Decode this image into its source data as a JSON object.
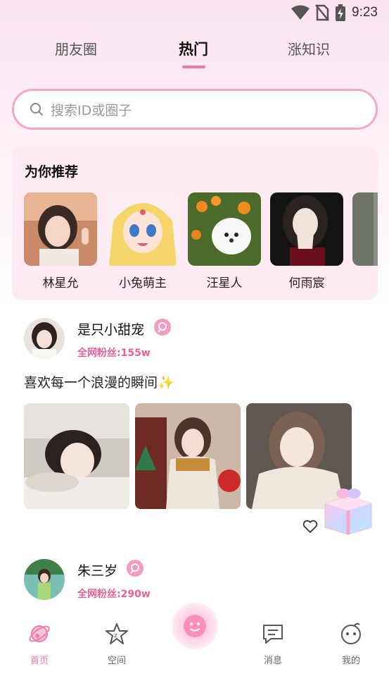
{
  "status_bar": {
    "time": "9:23"
  },
  "tabs": [
    {
      "label": "朋友圈"
    },
    {
      "label": "热门",
      "active": true
    },
    {
      "label": "涨知识"
    }
  ],
  "search": {
    "placeholder": "搜索ID或圈子"
  },
  "recommend": {
    "title": "为你推荐",
    "users": [
      {
        "name": "林星允"
      },
      {
        "name": "小兔萌主"
      },
      {
        "name": "汪星人"
      },
      {
        "name": "何雨宸"
      }
    ]
  },
  "posts": [
    {
      "username": "是只小甜宠",
      "fans": "全网粉丝:155w",
      "text": "喜欢每一个浪漫的瞬间✨",
      "image_count": 3
    },
    {
      "username": "朱三岁",
      "fans": "全网粉丝:290w"
    }
  ],
  "bottom_nav": [
    {
      "label": "首页",
      "icon": "home-planet-icon",
      "active": true
    },
    {
      "label": "空间",
      "icon": "star-space-icon"
    },
    {
      "label": "",
      "icon": "smiley-publish-icon"
    },
    {
      "label": "消息",
      "icon": "message-icon"
    },
    {
      "label": "我的",
      "icon": "profile-face-icon"
    }
  ],
  "colors": {
    "accent": "#f37aa8",
    "fans": "#ee5f95",
    "search_border": "#f6a6c6",
    "recommend_bg": "#fdeaf3"
  }
}
